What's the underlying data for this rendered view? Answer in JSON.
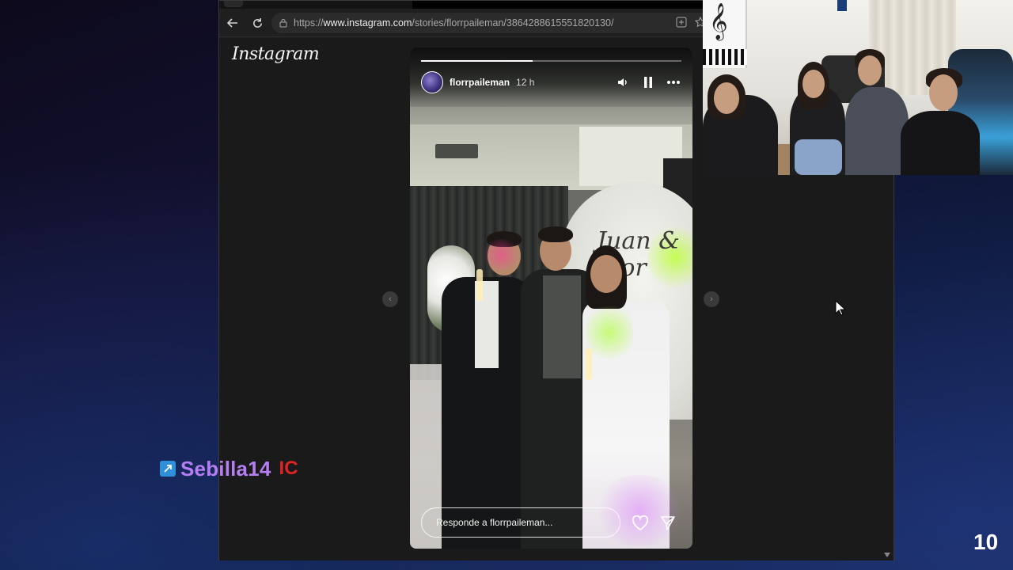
{
  "browser": {
    "url_prefix": "https://",
    "url_domain": "www.instagram.com",
    "url_path": "/stories/florrpaileman/3864288615551820130/",
    "back_icon": "back-arrow-icon",
    "reload_icon": "reload-icon"
  },
  "instagram": {
    "logo": "Instagram"
  },
  "story": {
    "username": "florrpaileman",
    "time": "12 h",
    "progress": 0.43,
    "arch_text": "Juan & Flor",
    "reply_placeholder": "Responde a florrpaileman...",
    "icons": [
      "volume-icon",
      "pause-icon",
      "more-options-icon",
      "heart-icon",
      "share-icon"
    ]
  },
  "overlay": {
    "streamer_name": "Sebilla14",
    "streamer_badge": "IC",
    "counter": "10"
  },
  "colors": {
    "streamer_name": "#b57ef2",
    "badge": "#e02424",
    "platform_icon": "#2f8fd8"
  }
}
